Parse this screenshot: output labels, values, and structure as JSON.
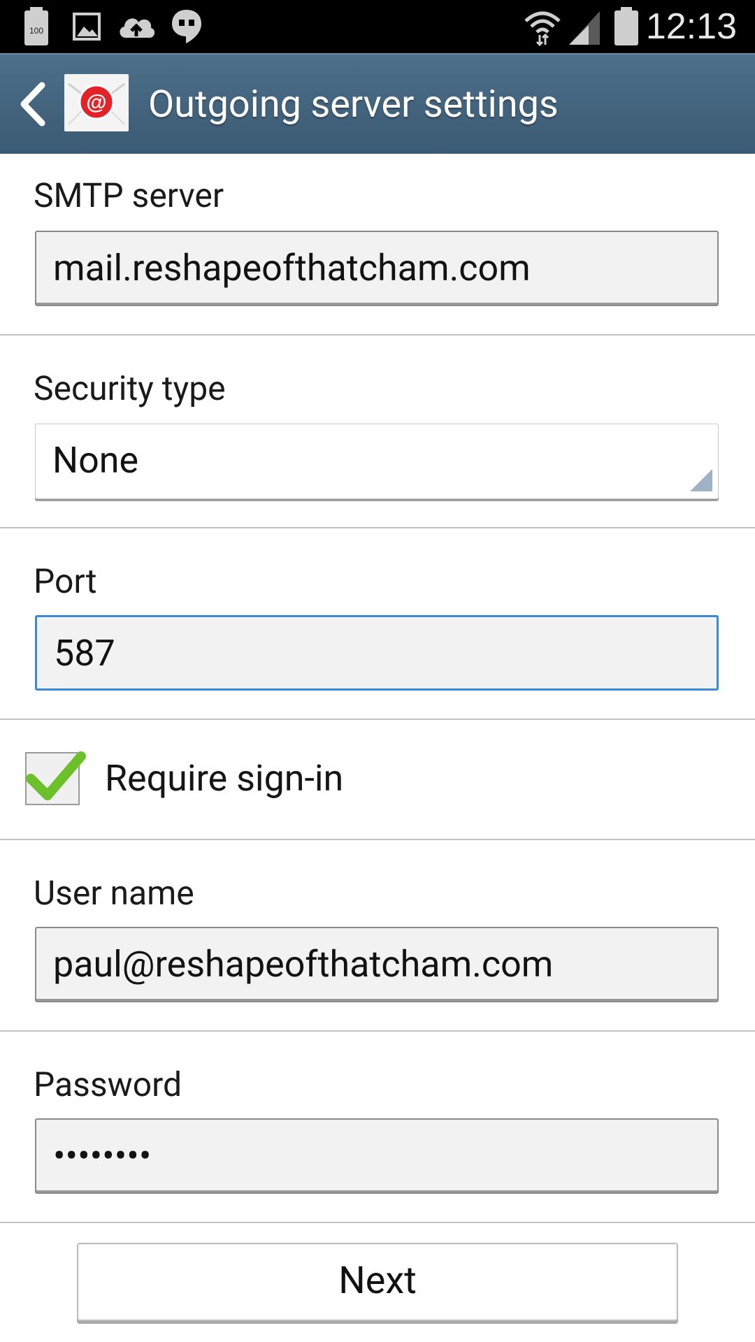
{
  "status_bar": {
    "time": "12:13",
    "battery_label": "100",
    "icons": [
      "battery-100-icon",
      "gallery-icon",
      "cloud-upload-icon",
      "hangouts-icon",
      "wifi-icon",
      "signal-icon",
      "battery-icon"
    ]
  },
  "header": {
    "title": "Outgoing server settings",
    "back_icon": "chevron-left-icon",
    "app_icon": "email-app-icon"
  },
  "form": {
    "smtp_label": "SMTP server",
    "smtp_value": "mail.reshapeofthatcham.com",
    "security_label": "Security type",
    "security_value": "None",
    "port_label": "Port",
    "port_value": "587",
    "require_signin_label": "Require sign-in",
    "require_signin_checked": true,
    "username_label": "User name",
    "username_value": "paul@reshapeofthatcham.com",
    "password_label": "Password",
    "password_value": "••••••••"
  },
  "footer": {
    "next_label": "Next"
  },
  "colors": {
    "status_bar": "#000000",
    "action_bar": "#45667f",
    "focus_border": "#3a8ad8",
    "checkmark": "#6cc12a"
  }
}
